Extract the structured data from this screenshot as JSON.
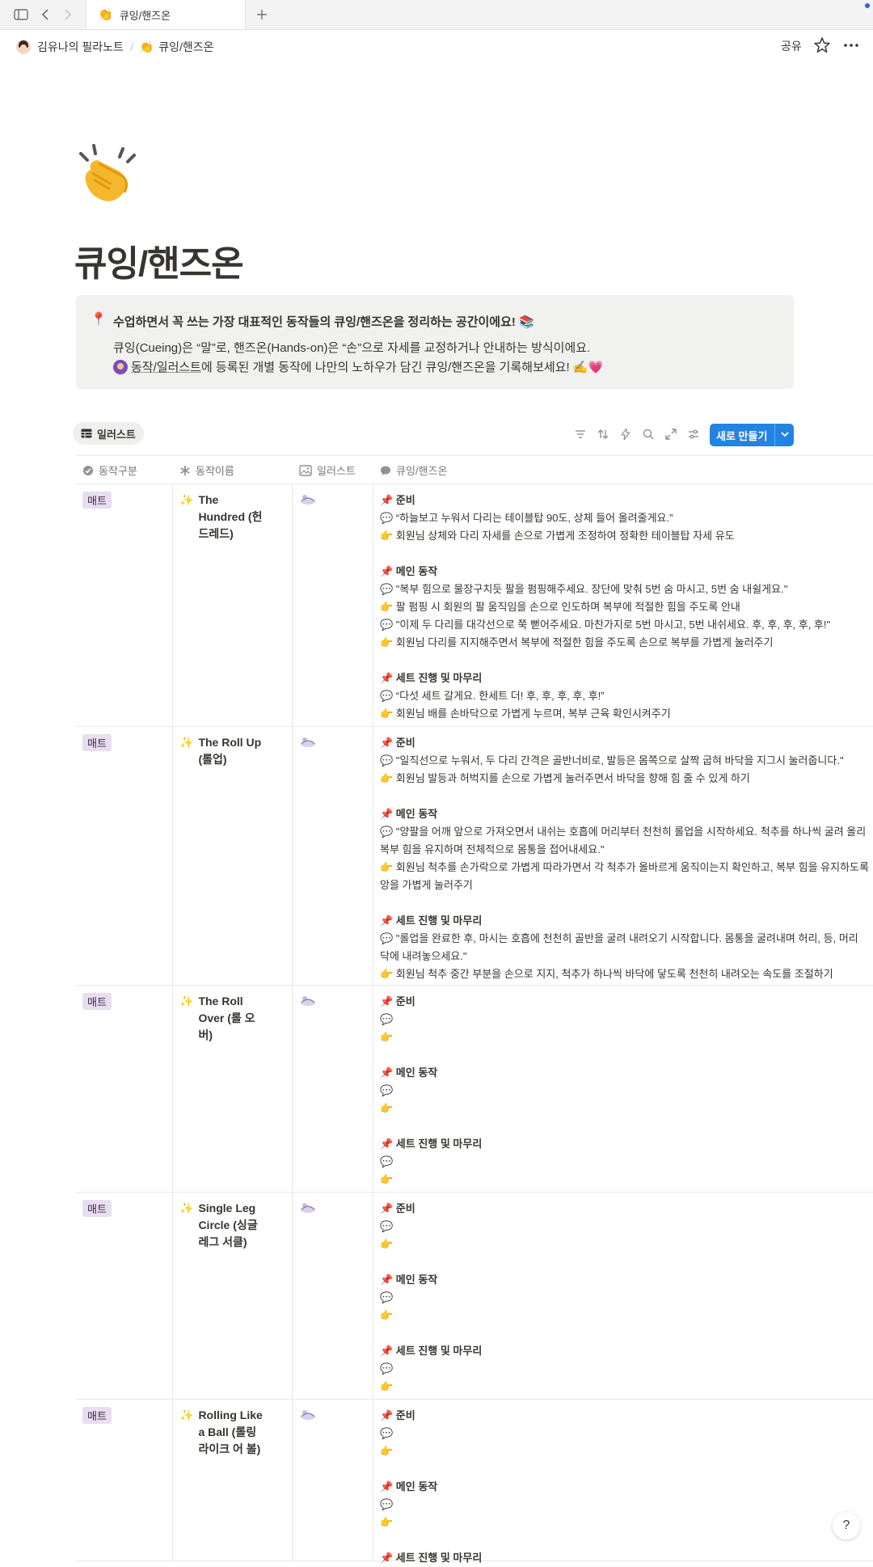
{
  "browser": {
    "tab_emoji": "👏",
    "tab_title": "큐잉/핸즈온"
  },
  "topbar": {
    "workspace": "김유나의 필라노트",
    "page_emoji": "👏",
    "page": "큐잉/핸즈온",
    "share": "공유"
  },
  "page": {
    "icon": "clapping-hands-icon",
    "title": "큐잉/핸즈온"
  },
  "callout": {
    "icon": "📍",
    "line1": "수업하면서 꼭 쓰는 가장 대표적인 동작들의 큐잉/핸즈온을 정리하는 공간이에요! 📚",
    "line2": "큐잉(Cueing)은 “말”로, 핸즈온(Hands-on)은 “손”으로 자세를 교정하거나 안내하는 방식이에요.",
    "line3_link": "동작/일러스트",
    "line3_rest": "에 등록된 개별 동작에 나만의 노하우가 담긴 큐잉/핸즈온을 기록해보세요! ✍️💗"
  },
  "database": {
    "view_label": "일러스트",
    "new_button": "새로 만들기",
    "columns": [
      "동작구분",
      "동작이름",
      "일러스트",
      "큐잉/핸즈온"
    ],
    "rows": [
      {
        "category": "매트",
        "name": "The Hundred (헌드레드)",
        "sections": [
          {
            "title": "📌 준비",
            "lines": [
              "💬 “하늘보고 누워서 다리는 테이블탑 90도, 상체 들어 올려줄게요.”",
              "👉 회원님 상체와 다리 자세를 손으로 가볍게 조정하여 정확한 테이블탑 자세 유도"
            ]
          },
          {
            "title": "📌 메인 동작",
            "lines": [
              "💬 \"복부 힘으로 물장구치듯 팔을 펌핑해주세요. 장단에 맞춰 5번 숨 마시고, 5번 숨 내쉴게요.\"",
              "👉 팔 펌핑 시 회원의 팔 움직임을 손으로 인도하며 복부에 적절한 힘을 주도록 안내",
              "💬 \"이제 두 다리를 대각선으로 쭉 뻗어주세요. 마찬가지로 5번 마시고, 5번 내쉬세요. 후, 후, 후, 후, 후!\"",
              "👉 회원님 다리를 지지해주면서 복부에 적절한 힘을 주도록 손으로 복부를 가볍게 눌러주기"
            ]
          },
          {
            "title": "📌 세트 진행 및 마무리",
            "lines": [
              "💬 “다섯 세트 갈게요. 한세트 더! 후, 후, 후, 후, 후!”",
              "👉  회원님 배를 손바닥으로 가볍게 누르며, 복부 근육 확인시켜주기"
            ]
          }
        ]
      },
      {
        "category": "매트",
        "name": "The Roll Up (롤업)",
        "sections": [
          {
            "title": "📌 준비",
            "lines": [
              "💬 \"일직선으로 누워서, 두 다리 간격은 골반너비로, 발등은 몸쪽으로 살짝 굽혀 바닥을 지그시 눌러줍니다.\"",
              "👉 회원님 발등과 허벅지를 손으로 가볍게 눌러주면서 바닥을 향해 힘 줄 수 있게 하기"
            ]
          },
          {
            "title": "📌 메인 동작",
            "lines": [
              "💬 \"양팔을 어깨 앞으로 가져오면서 내쉬는 호흡에 머리부터 천천히 롤업을 시작하세요. 척추를 하나씩 굴려 올리",
              "복부 힘을 유지하며 전체적으로 몸통을 접어내세요.\"",
              "👉 회원님 척추를 손가락으로 가볍게 따라가면서 각 척추가 올바르게 움직이는지 확인하고, 복부 힘을 유지하도록",
              "앙을 가볍게 눌러주기"
            ]
          },
          {
            "title": "📌 세트 진행 및 마무리",
            "lines": [
              "💬 \"롤업을 완료한 후, 마시는 호흡에 천천히 골반을 굴려 내려오기 시작합니다. 몸통을 굴려내며 허리, 등, 머리",
              "닥에 내려놓으세요.\"",
              "👉 회원님 척추 중간 부분을 손으로 지지, 척추가 하나씩 바닥에 닿도록 천천히 내려오는 속도를 조절하기"
            ]
          }
        ]
      },
      {
        "category": "매트",
        "name": "The Roll Over (롤 오버)",
        "sections": [
          {
            "title": "📌 준비",
            "lines": [
              "💬",
              "👉"
            ]
          },
          {
            "title": "📌 메인 동작",
            "lines": [
              "💬",
              "👉"
            ]
          },
          {
            "title": "📌 세트 진행 및 마무리",
            "lines": [
              "💬",
              "👉"
            ]
          }
        ]
      },
      {
        "category": "매트",
        "name": "Single Leg Circle (싱글 레그 서클)",
        "sections": [
          {
            "title": "📌 준비",
            "lines": [
              "💬",
              "👉"
            ]
          },
          {
            "title": "📌 메인 동작",
            "lines": [
              "💬",
              "👉"
            ]
          },
          {
            "title": "📌 세트 진행 및 마무리",
            "lines": [
              "💬",
              "👉"
            ]
          }
        ]
      },
      {
        "category": "매트",
        "name": "Rolling Like a Ball (롤링 라이크 어 볼)",
        "sections": [
          {
            "title": "📌 준비",
            "lines": [
              "💬",
              "👉"
            ]
          },
          {
            "title": "📌 메인 동작",
            "lines": [
              "💬",
              "👉"
            ]
          },
          {
            "title": "📌 세트 진행 및 마무리",
            "lines": []
          }
        ]
      }
    ]
  },
  "colors": {
    "accent": "#2383e2",
    "badge_bg": "#e8deee",
    "callout_bg": "#f1f1ef"
  }
}
